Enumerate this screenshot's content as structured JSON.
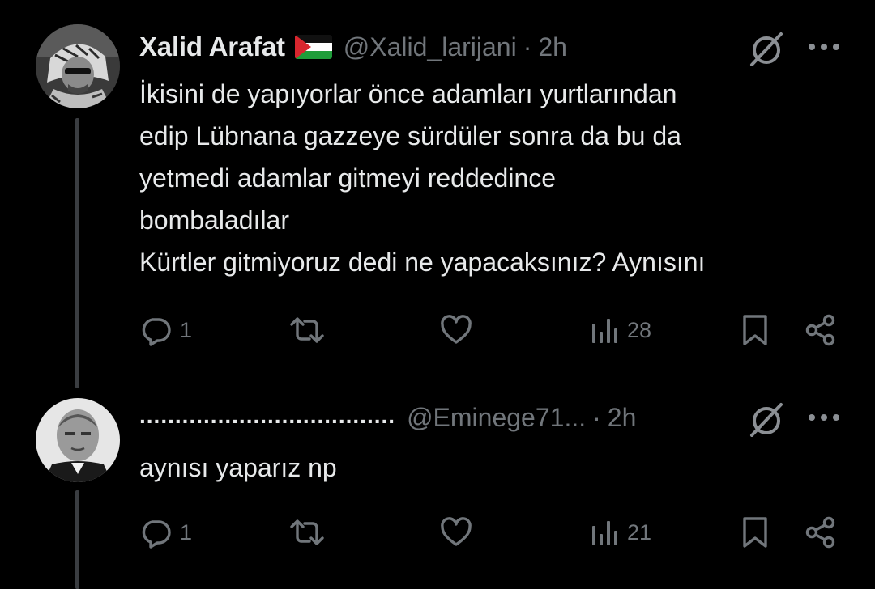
{
  "colors": {
    "background": "#000000",
    "text_primary": "#e7e9ea",
    "text_secondary": "#71767b",
    "thread_line": "#3a3d41"
  },
  "tweets": [
    {
      "display_name": "Xalid Arafat",
      "flag_icon": "palestine-flag-icon",
      "handle": "@Xalid_larijani",
      "separator": "·",
      "time": "2h",
      "text": "İkisini de yapıyorlar önce adamları yurtlarından\nedip Lübnana gazzeye sürdüler sonra da bu da\nyetmedi adamlar gitmeyi reddedince\nbombaladılar\nKürtler gitmiyoruz dedi ne yapacaksınız? Aynısını",
      "reply_count": "1",
      "views_count": "28"
    },
    {
      "display_name": "....................................",
      "handle": "@Eminege71...",
      "separator": "·",
      "time": "2h",
      "text": "aynısı yaparız np",
      "reply_count": "1",
      "views_count": "21"
    }
  ]
}
